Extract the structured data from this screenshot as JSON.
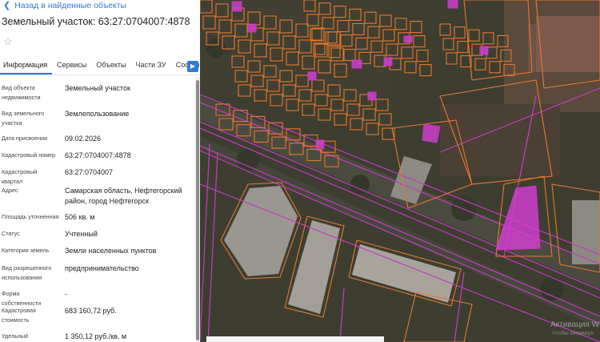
{
  "header": {
    "back_label": "Назад в найденные объекты",
    "title": "Земельный участок: 63:27:0704007:4878"
  },
  "tabs": [
    "Информация",
    "Сервисы",
    "Объекты",
    "Части ЗУ",
    "Состав"
  ],
  "info": [
    {
      "label": "Вид объекта недвижимости",
      "value": "Земельный участок"
    },
    {
      "label": "Вид земельного участка",
      "value": "Землепользование"
    },
    {
      "label": "Дата присвоения",
      "value": "09.02.2026"
    },
    {
      "label": "Кадастровый номер",
      "value": "63:27:0704007:4878"
    },
    {
      "label": "Кадастровый квартал",
      "value": "63:27:0704007"
    },
    {
      "label": "Адрес",
      "value": "Самарская область, Нефтегорский район, город Нефтегорск"
    },
    {
      "label": "Площадь уточненная",
      "value": "506 кв. м"
    },
    {
      "label": "Статус",
      "value": "Учтенный"
    },
    {
      "label": "Категория земель",
      "value": "Земли населенных пунктов"
    },
    {
      "label": "Вид разрешенного использования",
      "value": "предпринимательство"
    },
    {
      "label": "Форма собственности",
      "value": "-"
    },
    {
      "label": "Кадастровая стоимость",
      "value": "683 160,72 руб."
    },
    {
      "label": "Удельный показатель",
      "value": "1 350,12 руб./кв. м"
    }
  ],
  "map": {
    "watermark_title": "Активация W",
    "watermark_sub": "Чтобы активиро",
    "colors": {
      "parcel": "#e8772e",
      "highlight": "#d63fd6",
      "boundary": "#c43bc4"
    }
  }
}
